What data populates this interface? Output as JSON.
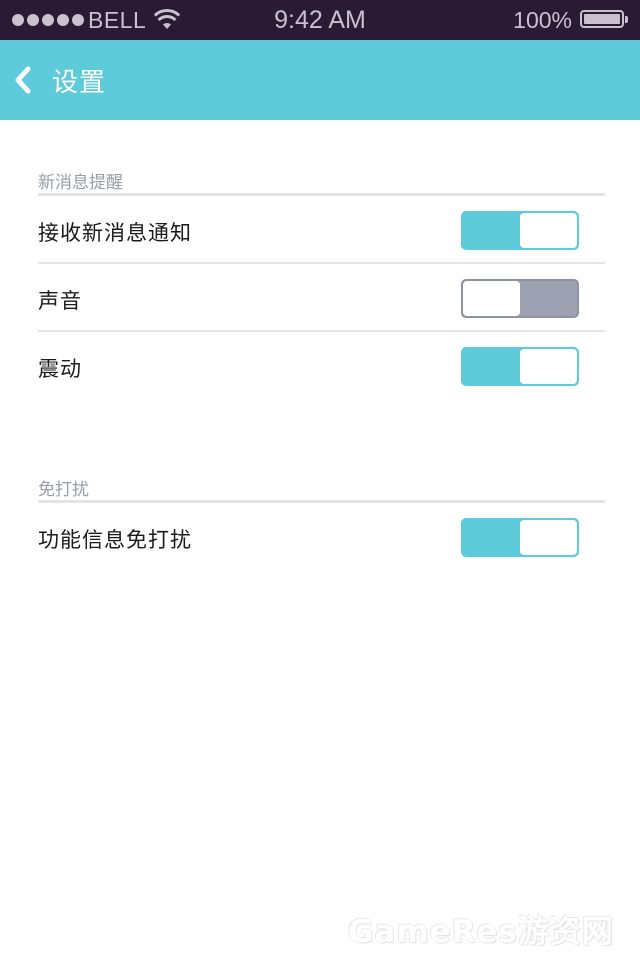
{
  "status_bar": {
    "carrier": "BELL",
    "time": "9:42 AM",
    "battery": "100%",
    "signal_bars": 5,
    "battery_level": 1.0
  },
  "nav": {
    "back_icon": "chevron-left-icon",
    "title": "设置"
  },
  "sections": [
    {
      "header": "新消息提醒",
      "rows": [
        {
          "label": "接收新消息通知",
          "enabled": true
        },
        {
          "label": "声音",
          "enabled": false
        },
        {
          "label": "震动",
          "enabled": true
        }
      ]
    },
    {
      "header": "免打扰",
      "rows": [
        {
          "label": "功能信息免打扰",
          "enabled": true
        }
      ]
    }
  ],
  "watermark": "GameRes游资网",
  "colors": {
    "accent": "#5ecbda",
    "toggle_off": "#9ea1b2",
    "status_bar_bg": "#2a1a33",
    "section_header_text": "#9a9da9"
  }
}
